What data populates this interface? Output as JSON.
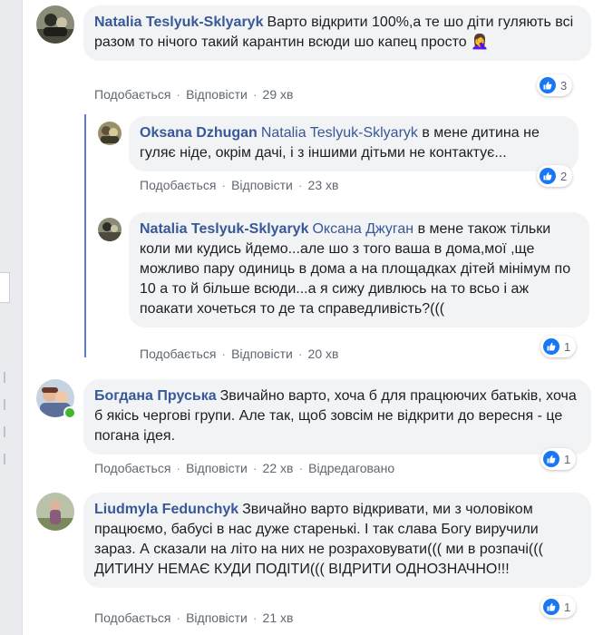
{
  "actions": {
    "like": "Подобається",
    "reply": "Відповісти",
    "edited": "Відредаговано"
  },
  "colors": {
    "author": "#385898",
    "bubble": "#f2f3f5",
    "thread_line": "#5b7bd5",
    "like": "#1877f2"
  },
  "comments": [
    {
      "author": "Natalia Teslyuk-Sklyaryk",
      "text": "Варто відкрити 100%,а те шо діти гуляють всі разом то нічого такий карантин всюди шо капец просто 🤦‍♀️",
      "time": "29 хв",
      "reactions": "3",
      "reaction_icon": "like-icon"
    },
    {
      "author": "Oksana Dzhugan",
      "mention": "Natalia Teslyuk-Sklyaryk",
      "text": "в мене дитина не гуляє ніде, окрім дачі, і з іншими дітьми не контактує...",
      "time": "23 хв",
      "reactions": "2",
      "reaction_icon": "like-icon"
    },
    {
      "author": "Natalia Teslyuk-Sklyaryk",
      "mention": "Оксана Джуган",
      "text": "в мене також тільки коли ми кудись йдемо...але шо з того ваша в дома,мої ,ще можливо пару одиниць в дома а на площадках дітей мінімум по 10 а то й більше всюди...а я сижу дивлюсь на то всьо і аж поакати хочеться то де та справедливість?(((",
      "time": "20 хв",
      "reactions": "1",
      "reaction_icon": "like-icon"
    },
    {
      "author": "Богдана Пруська",
      "text": "Звичайно варто, хоча б для працюючих батьків, хоча б якісь чергові групи. Але так, щоб зовсім не відкрити до вересня - це погана ідея.",
      "time": "22 хв",
      "edited": true,
      "reactions": "1",
      "reaction_icon": "like-icon"
    },
    {
      "author": "Liudmyla Fedunchyk",
      "text": "Звичайно варто відкривати, ми з чоловіком працюємо, бабусі в нас дуже старенькі. І так слава Богу виручили зараз. А сказали на літо на них не розраховувати((( ми в розпачі((( ДИТИНУ НЕМАЄ КУДИ ПОДІТИ((( ВІДРИТИ ОДНОЗНАЧНО!!!",
      "time": "21 хв",
      "reactions": "1",
      "reaction_icon": "like-icon"
    }
  ]
}
